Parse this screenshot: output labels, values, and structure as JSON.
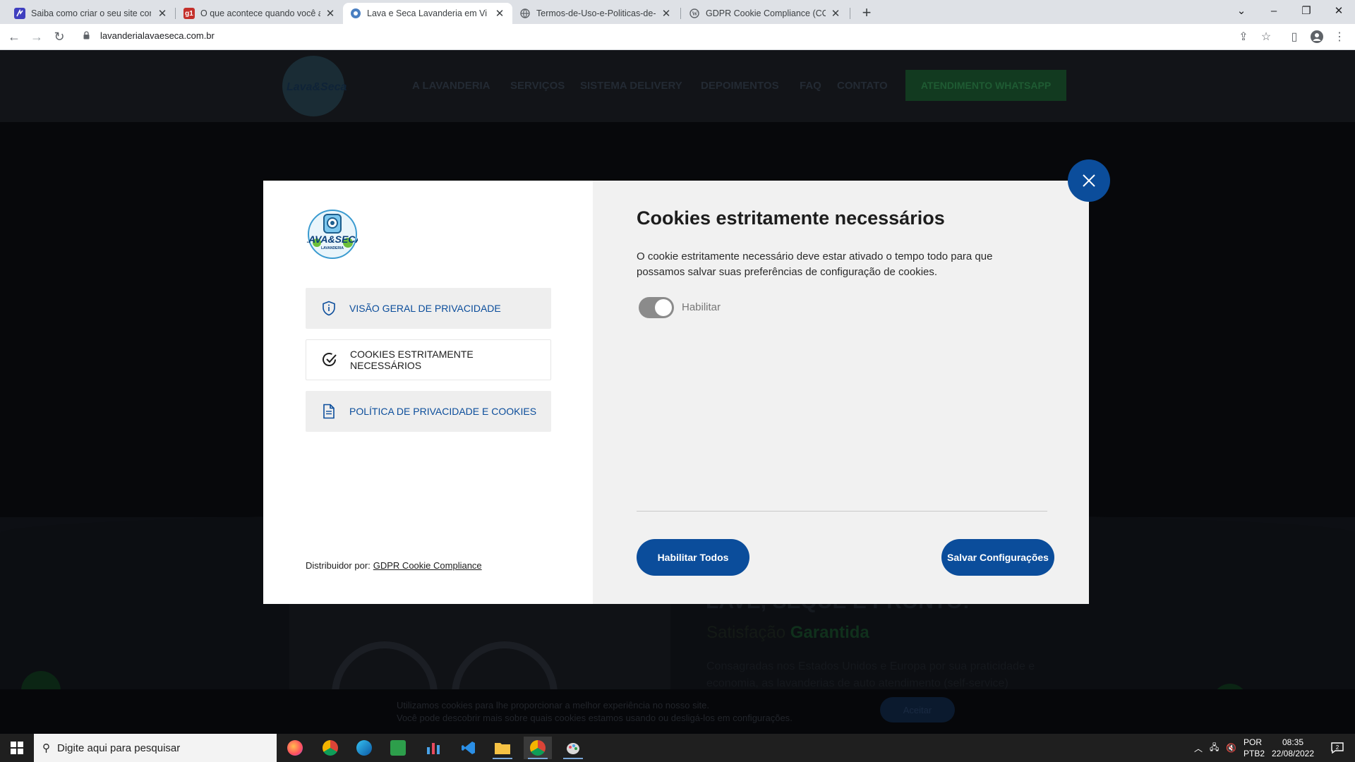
{
  "browser": {
    "tabs": [
      {
        "title": "Saiba como criar o seu site com a",
        "favicon_color": "#3f3fbf"
      },
      {
        "title": "O que acontece quando você ac",
        "favicon_color": "#c4302b",
        "favicon_text": "g1"
      },
      {
        "title": "Lava e Seca Lavanderia em Vila V",
        "favicon_color": "#4a7fc1"
      },
      {
        "title": "Termos-de-Uso-e-Politicas-de-Pr",
        "favicon_color": "#5f6368"
      },
      {
        "title": "GDPR Cookie Compliance (CCPA",
        "favicon_color": "#5f6368"
      }
    ],
    "url": "lavanderialavaeseca.com.br"
  },
  "site": {
    "logo_text": "Lava&Seca",
    "nav": [
      "A LAVANDERIA",
      "SERVIÇOS",
      "SISTEMA DELIVERY",
      "DEPOIMENTOS",
      "FAQ",
      "CONTATO"
    ],
    "nav_cta": "ATENDIMENTO WHATSAPP",
    "hero_title": "LAVE, SEQUE E PRONTO!",
    "hero_sub_plain": "Satisfação",
    "hero_sub_bold": "Garantida",
    "hero_paragraph": "Consagradas nos Estados Unidos e Europa por sua praticidade e economia, as lavanderias de auto atendimento (self-service)",
    "cookie_bar_line1": "Utilizamos cookies para lhe proporcionar a melhor experiência no nosso site.",
    "cookie_bar_line2": "Você pode descobrir mais sobre quais cookies estamos usando ou desligá-los em",
    "cookie_bar_link": "configurações",
    "cookie_bar_end": ".",
    "cookie_bar_accept": "Aceitar"
  },
  "modal": {
    "logo_text": "LAVA&SECA",
    "logo_small": "LAVANDERIA",
    "menu": [
      {
        "label": "VISÃO GERAL DE PRIVACIDADE",
        "icon": "shield-icon",
        "active": false
      },
      {
        "label": "COOKIES ESTRITAMENTE NECESSÁRIOS",
        "icon": "check-circle-icon",
        "active": true
      },
      {
        "label": "POLÍTICA DE PRIVACIDADE E COOKIES",
        "icon": "document-icon",
        "active": false
      }
    ],
    "powered_label": "Distribuidor por:",
    "powered_link": "GDPR Cookie Compliance",
    "title": "Cookies estritamente necessários",
    "description": "O cookie estritamente necessário deve estar ativado o tempo todo para que possamos salvar suas preferências de configuração de cookies.",
    "toggle_label": "Habilitar",
    "toggle_on": true,
    "btn_enable_all": "Habilitar Todos",
    "btn_save": "Salvar Configurações",
    "accent_color": "#0b4d9b"
  },
  "taskbar": {
    "search_placeholder": "Digite aqui para pesquisar",
    "lang_line1": "POR",
    "lang_line2": "PTB2",
    "time": "08:35",
    "date": "22/08/2022",
    "notification_count": "2"
  }
}
